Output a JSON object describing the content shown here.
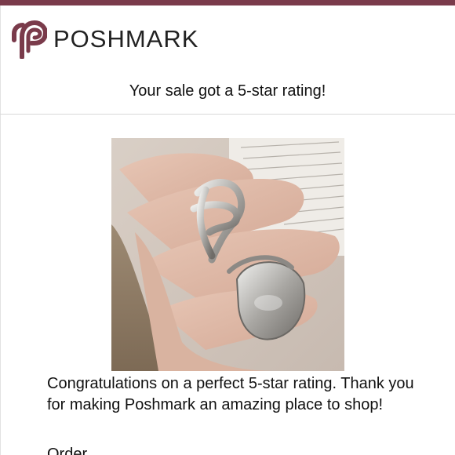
{
  "brand": {
    "name": "POSHMARK",
    "color": "#7a3b4b"
  },
  "email": {
    "headline": "Your sale got a 5-star rating!",
    "message": "Congratulations on a perfect 5-star rating. Thank you for making Poshmark an amazing place to shop!",
    "order_label": "Order"
  },
  "icons": {
    "logo": "poshmark-logo-icon"
  }
}
